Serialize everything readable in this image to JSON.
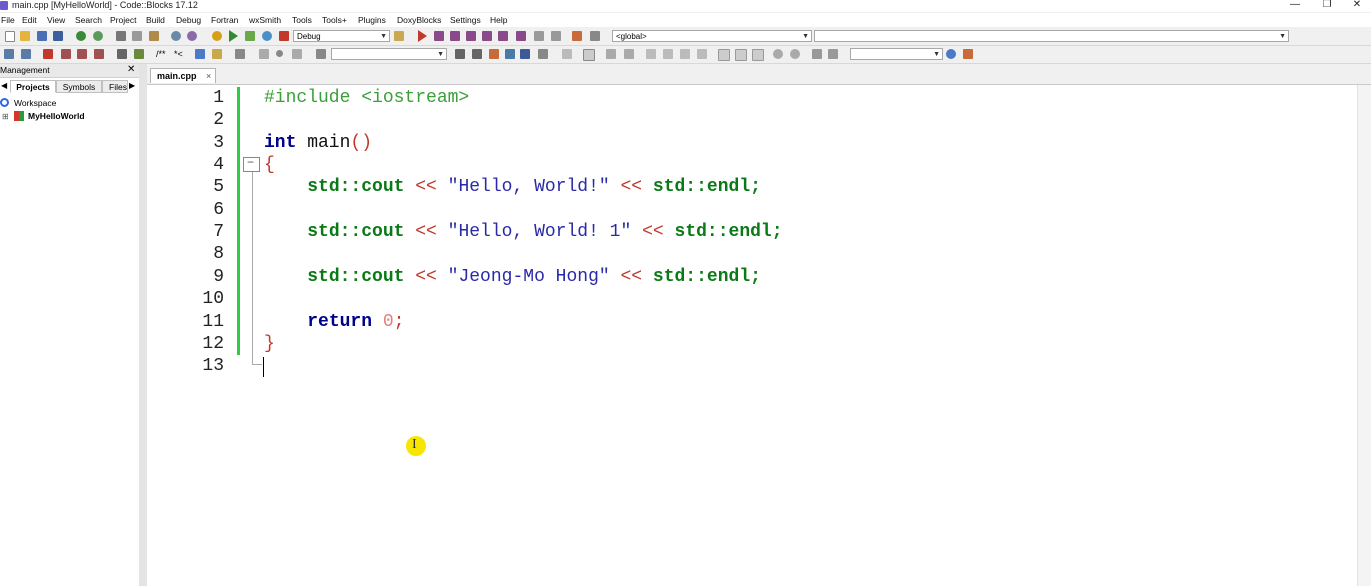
{
  "window": {
    "title": "main.cpp [MyHelloWorld] - Code::Blocks 17.12",
    "minimize_glyph": "—",
    "restore_glyph": "❐",
    "close_glyph": "✕"
  },
  "menu": [
    "File",
    "Edit",
    "View",
    "Search",
    "Project",
    "Build",
    "Debug",
    "Fortran",
    "wxSmith",
    "Tools",
    "Tools+",
    "Plugins",
    "DoxyBlocks",
    "Settings",
    "Help"
  ],
  "toolbar": {
    "build_target": "Debug",
    "scope": "<global>",
    "symbol": "",
    "search_text": "",
    "doxy_labels": [
      "/**",
      "*<"
    ],
    "icons": [
      "new-file-icon",
      "open-icon",
      "save-icon",
      "save-all-icon",
      "undo-icon",
      "redo-icon",
      "cut-icon",
      "copy-icon",
      "paste-icon",
      "find-icon",
      "replace-icon",
      "build-icon",
      "run-icon",
      "build-run-icon",
      "rebuild-icon",
      "abort-icon",
      "debug-start-icon",
      "stop-debug-icon"
    ],
    "colors": {
      "build": "#d4a017",
      "run": "#2e8b2e",
      "abort": "#c0392b",
      "debug": "#c0392b"
    }
  },
  "management": {
    "title": "Management",
    "close_glyph": "✕",
    "tabs": [
      "Projects",
      "Symbols",
      "Files"
    ],
    "active_tab": "Projects",
    "tree": {
      "workspace_label": "Workspace",
      "project_label": "MyHelloWorld"
    }
  },
  "editor": {
    "tab_label": "main.cpp",
    "tab_close": "×",
    "line_numbers": [
      "1",
      "2",
      "3",
      "4",
      "5",
      "6",
      "7",
      "8",
      "9",
      "10",
      "11",
      "12",
      "13"
    ],
    "lines": [
      {
        "n": 1,
        "tokens": [
          {
            "t": "#include <iostream>",
            "c": "pp"
          }
        ]
      },
      {
        "n": 2,
        "tokens": []
      },
      {
        "n": 3,
        "tokens": [
          {
            "t": "int",
            "c": "kw"
          },
          {
            "t": " main",
            "c": "pl"
          },
          {
            "t": "()",
            "c": "op"
          }
        ]
      },
      {
        "n": 4,
        "tokens": [
          {
            "t": "{",
            "c": "op"
          }
        ]
      },
      {
        "n": 5,
        "tokens": [
          {
            "t": "    ",
            "c": "pl"
          },
          {
            "t": "std::cout",
            "c": "std"
          },
          {
            "t": " << ",
            "c": "op"
          },
          {
            "t": "\"Hello, World!\"",
            "c": "str"
          },
          {
            "t": " << ",
            "c": "op"
          },
          {
            "t": "std::endl",
            "c": "std"
          },
          {
            "t": ";",
            "c": "std"
          }
        ]
      },
      {
        "n": 6,
        "tokens": []
      },
      {
        "n": 7,
        "tokens": [
          {
            "t": "    ",
            "c": "pl"
          },
          {
            "t": "std::cout",
            "c": "std"
          },
          {
            "t": " << ",
            "c": "op"
          },
          {
            "t": "\"Hello, World! 1\"",
            "c": "str"
          },
          {
            "t": " << ",
            "c": "op"
          },
          {
            "t": "std::endl",
            "c": "std"
          },
          {
            "t": ";",
            "c": "std"
          }
        ]
      },
      {
        "n": 8,
        "tokens": []
      },
      {
        "n": 9,
        "tokens": [
          {
            "t": "    ",
            "c": "pl"
          },
          {
            "t": "std::cout",
            "c": "std"
          },
          {
            "t": " << ",
            "c": "op"
          },
          {
            "t": "\"Jeong-Mo Hong\"",
            "c": "str"
          },
          {
            "t": " << ",
            "c": "op"
          },
          {
            "t": "std::endl",
            "c": "std"
          },
          {
            "t": ";",
            "c": "std"
          }
        ]
      },
      {
        "n": 10,
        "tokens": []
      },
      {
        "n": 11,
        "tokens": [
          {
            "t": "    ",
            "c": "pl"
          },
          {
            "t": "return",
            "c": "kw"
          },
          {
            "t": " ",
            "c": "pl"
          },
          {
            "t": "0",
            "c": "num"
          },
          {
            "t": ";",
            "c": "op"
          }
        ]
      },
      {
        "n": 12,
        "tokens": [
          {
            "t": "}",
            "c": "op"
          }
        ]
      },
      {
        "n": 13,
        "tokens": []
      }
    ],
    "fold_glyph": "−",
    "cursor_glyph": "I"
  }
}
